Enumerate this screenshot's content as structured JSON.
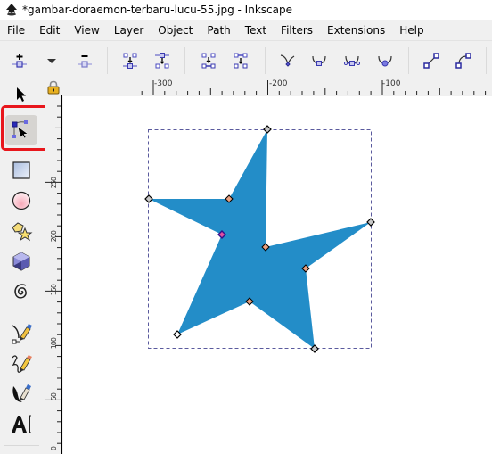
{
  "window": {
    "title": "*gambar-doraemon-terbaru-lucu-55.jpg - Inkscape",
    "app_icon": "inkscape-logo-icon"
  },
  "menu": [
    "File",
    "Edit",
    "View",
    "Layer",
    "Object",
    "Path",
    "Text",
    "Filters",
    "Extensions",
    "Help"
  ],
  "tool_controls": {
    "buttons": [
      {
        "name": "insert-node-button",
        "icon": "node-add-icon"
      },
      {
        "name": "insert-node-dropdown",
        "icon": "dropdown-arrow-icon"
      },
      {
        "name": "delete-node-button",
        "icon": "node-delete-icon"
      },
      {
        "name": "join-nodes-button",
        "icon": "node-join-icon"
      },
      {
        "name": "break-path-button",
        "icon": "node-break-icon"
      },
      {
        "name": "join-segment-button",
        "icon": "node-join-segment-icon"
      },
      {
        "name": "delete-segment-button",
        "icon": "node-delete-segment-icon"
      },
      {
        "name": "node-cusp-button",
        "icon": "node-type-cusp-icon"
      },
      {
        "name": "node-smooth-button",
        "icon": "node-type-smooth-icon"
      },
      {
        "name": "node-symmetric-button",
        "icon": "node-type-symmetric-icon"
      },
      {
        "name": "node-auto-smooth-button",
        "icon": "node-type-auto-smooth-icon"
      },
      {
        "name": "segment-line-button",
        "icon": "segment-line-icon"
      },
      {
        "name": "segment-curve-button",
        "icon": "segment-curve-icon"
      }
    ]
  },
  "toolbox": {
    "tools": [
      {
        "name": "selector-tool",
        "icon": "arrow-cursor-icon",
        "active": false
      },
      {
        "name": "node-tool",
        "icon": "node-editor-icon",
        "active": true
      },
      {
        "name": "rectangle-tool",
        "icon": "rectangle-icon",
        "active": false
      },
      {
        "name": "ellipse-tool",
        "icon": "circle-icon",
        "active": false
      },
      {
        "name": "star-tool",
        "icon": "star-polygon-icon",
        "active": false
      },
      {
        "name": "3d-box-tool",
        "icon": "cube-icon",
        "active": false
      },
      {
        "name": "spiral-tool",
        "icon": "spiral-icon",
        "active": false
      },
      {
        "name": "pen-tool",
        "icon": "bezier-pen-icon",
        "active": false
      },
      {
        "name": "pencil-tool",
        "icon": "pencil-icon",
        "active": false
      },
      {
        "name": "calligraphy-tool",
        "icon": "calligraphy-icon",
        "active": false
      },
      {
        "name": "text-tool",
        "icon": "text-icon",
        "active": false
      }
    ],
    "highlight_color": "#e8161c"
  },
  "rulers": {
    "horizontal_labels": [
      "-300",
      "-200",
      "-100"
    ],
    "vertical_labels": [
      "250",
      "200",
      "150",
      "100",
      "50",
      "0"
    ],
    "lock_icon": "lock-icon"
  },
  "canvas": {
    "shape": {
      "type": "star",
      "fill": "#238dc8",
      "corner_nodes": 5,
      "inner_nodes": 5
    },
    "bbox_stroke": "#5a5a9e"
  }
}
